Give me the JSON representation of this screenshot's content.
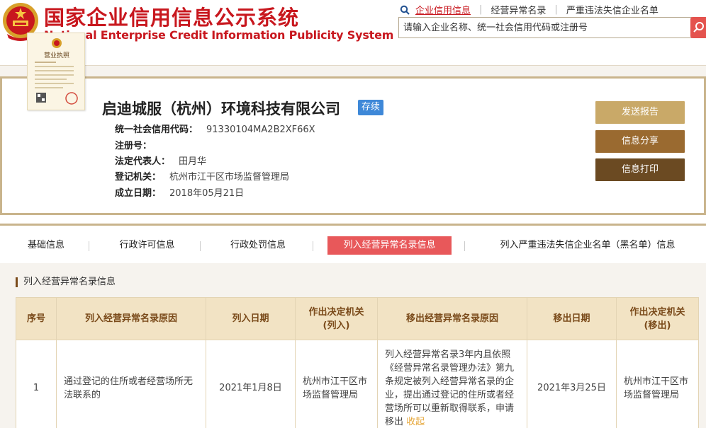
{
  "header": {
    "title_cn": "国家企业信用信息公示系统",
    "title_en": "National Enterprise Credit Information Publicity System",
    "links": [
      "企业信用信息",
      "经营异常名录",
      "严重违法失信企业名单"
    ],
    "search_placeholder": "请输入企业名称、统一社会信用代码或注册号"
  },
  "company": {
    "name": "启迪城服（杭州）环境科技有限公司",
    "status": "存续",
    "fields": [
      {
        "key": "统一社会信用代码：",
        "value": "91330104MA2B2XF66X"
      },
      {
        "key": "注册号：",
        "value": ""
      },
      {
        "key": "法定代表人：",
        "value": "田月华"
      },
      {
        "key": "登记机关：",
        "value": "杭州市江干区市场监督管理局"
      },
      {
        "key": "成立日期：",
        "value": "2018年05月21日"
      }
    ],
    "license_label": "营业执照"
  },
  "actions": {
    "report": "发送报告",
    "share": "信息分享",
    "print": "信息打印"
  },
  "tabs": [
    "基础信息",
    "行政许可信息",
    "行政处罚信息",
    "列入经营异常名录信息",
    "列入严重违法失信企业名单（黑名单）信息"
  ],
  "active_tab": 3,
  "section": {
    "title": "列入经营异常名录信息",
    "columns": [
      "序号",
      "列入经营异常名录原因",
      "列入日期",
      "作出决定机关\n(列入)",
      "移出经营异常名录原因",
      "移出日期",
      "作出决定机关\n(移出)"
    ],
    "rows": [
      {
        "index": "1",
        "reason_in": "通过登记的住所或者经营场所无法联系的",
        "date_in": "2021年1月8日",
        "org_in": "杭州市江干区市场监督管理局",
        "reason_out": "列入经营异常名录3年内且依照《经营异常名录管理办法》第九条规定被列入经营异常名录的企业，提出通过登记的住所或者经营场所可以重新取得联系，申请移出",
        "reason_out_link": "收起",
        "date_out": "2021年3月25日",
        "org_out": "杭州市江干区市场监督管理局"
      }
    ]
  },
  "colors": {
    "brand_red": "#c8171e",
    "active_tab": "#e8585a",
    "status_blue": "#3e88d8",
    "gold": "#c9a968",
    "brown": "#9a6a30",
    "dark_brown": "#6b4a22"
  }
}
